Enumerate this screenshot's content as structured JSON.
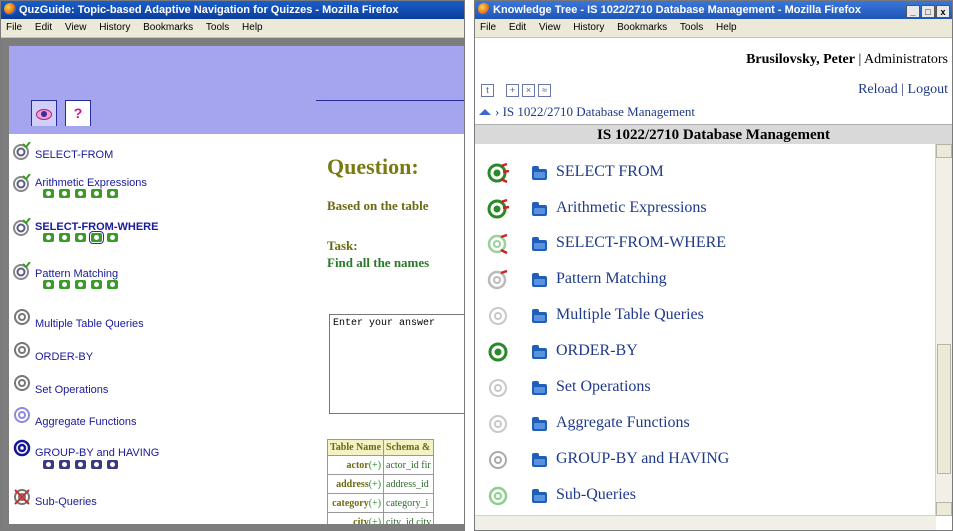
{
  "left_window": {
    "title": "QuzGuide: Topic-based Adaptive Navigation for Quizzes - Mozilla Firefox",
    "menu": [
      "File",
      "Edit",
      "View",
      "History",
      "Bookmarks",
      "Tools",
      "Help"
    ],
    "tabs": [
      "eye-icon",
      "?"
    ],
    "topics": [
      {
        "label": "SELECT-FROM",
        "icon": "target-check-icon",
        "minis": 0
      },
      {
        "label": "Arithmetic Expressions",
        "icon": "target-check-icon",
        "minis": 5
      },
      {
        "label": "SELECT-FROM-WHERE",
        "icon": "target-check-icon",
        "minis": 5,
        "selected_mini": 3
      },
      {
        "label": "Pattern Matching",
        "icon": "target-check-icon",
        "minis": 5
      },
      {
        "label": "Multiple Table Queries",
        "icon": "target-gray-icon",
        "minis": 0
      },
      {
        "label": "ORDER-BY",
        "icon": "target-gray-icon",
        "minis": 0
      },
      {
        "label": "Set Operations",
        "icon": "target-gray-icon",
        "minis": 0
      },
      {
        "label": "Aggregate Functions",
        "icon": "target-lightblue-icon",
        "minis": 0
      },
      {
        "label": "GROUP-BY and HAVING",
        "icon": "target-darkblue-icon",
        "minis": 5
      },
      {
        "label": "Sub-Queries",
        "icon": "target-crossed-icon",
        "minis": 0
      }
    ],
    "question": {
      "title": "Question:",
      "based": "Based on the table",
      "task_label": "Task:",
      "task_text": "Find all the names",
      "answer_placeholder": "Enter your answer"
    },
    "schema": {
      "headers": [
        "Table Name",
        "Schema &"
      ],
      "rows": [
        {
          "name": "actor",
          "plus": "(+)",
          "schema": "actor_id fir"
        },
        {
          "name": "address",
          "plus": "(+)",
          "schema": "address_id"
        },
        {
          "name": "category",
          "plus": "(+)",
          "schema": "category_i"
        },
        {
          "name": "city",
          "plus": "(+)",
          "schema": "city_id city"
        }
      ]
    }
  },
  "right_window": {
    "title": "Knowledge Tree - IS 1022/2710 Database Management - Mozilla Firefox",
    "menu": [
      "File",
      "Edit",
      "View",
      "History",
      "Bookmarks",
      "Tools",
      "Help"
    ],
    "user_name": "Brusilovsky, Peter",
    "separator": "|",
    "role": "Administrators",
    "reload": "Reload",
    "logout": "Logout",
    "breadcrumb": "IS 1022/2710 Database Management",
    "heading": "IS 1022/2710 Database Management",
    "topics": [
      {
        "label": "SELECT FROM",
        "icon": "target-green-red-icon"
      },
      {
        "label": "Arithmetic Expressions",
        "icon": "target-green-red-icon"
      },
      {
        "label": "SELECT-FROM-WHERE",
        "icon": "target-lightgreen-red-icon"
      },
      {
        "label": "Pattern Matching",
        "icon": "target-gray-red-icon"
      },
      {
        "label": "Multiple Table Queries",
        "icon": "target-lightgray-icon"
      },
      {
        "label": "ORDER-BY",
        "icon": "target-green-icon"
      },
      {
        "label": "Set Operations",
        "icon": "target-lightgray-icon"
      },
      {
        "label": "Aggregate Functions",
        "icon": "target-lightgray-icon"
      },
      {
        "label": "GROUP-BY and HAVING",
        "icon": "target-gray-icon"
      },
      {
        "label": "Sub-Queries",
        "icon": "target-lightgreen-icon"
      }
    ]
  },
  "colors": {
    "quiz_banner": "#a5a5ef",
    "topic_link": "#1a1a9a",
    "kt_link": "#1f3a8a",
    "question_title": "#7a7a14"
  }
}
